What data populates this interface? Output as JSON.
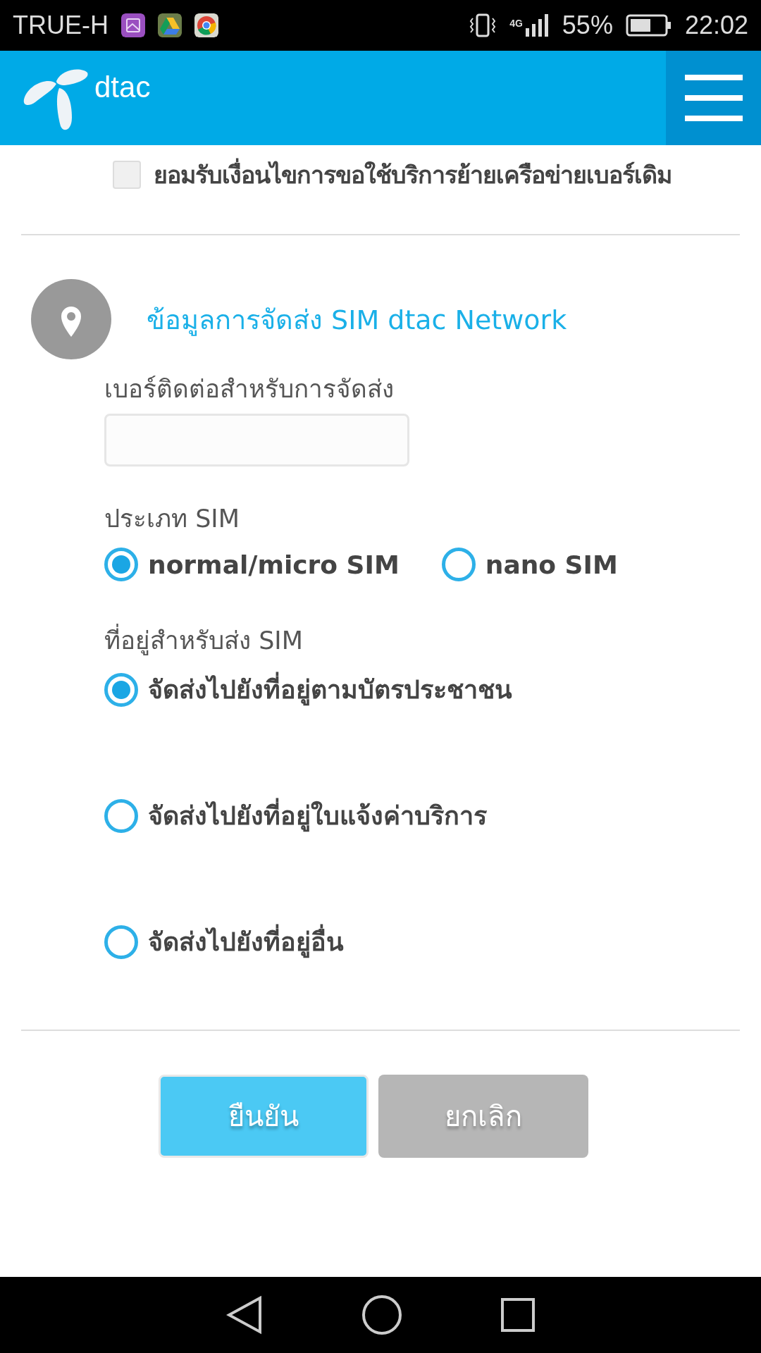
{
  "status_bar": {
    "carrier": "TRUE-H",
    "network": "4G",
    "battery": "55%",
    "time": "22:02"
  },
  "header": {
    "logo_text": "dtac"
  },
  "agreement": {
    "label": "ยอมรับเงื่อนไขการขอใช้บริการย้ายเครือข่ายเบอร์เดิม",
    "checked": false
  },
  "delivery": {
    "title": "ข้อมูลการจัดส่ง SIM dtac Network",
    "phone_field": {
      "label": "เบอร์ติดต่อสำหรับการจัดส่ง"
    },
    "sim_type": {
      "label": "ประเภท SIM",
      "options": [
        {
          "label": "normal/micro SIM",
          "selected": true
        },
        {
          "label": "nano SIM",
          "selected": false
        }
      ]
    },
    "address": {
      "label": "ที่อยู่สำหรับส่ง SIM",
      "options": [
        {
          "label": "จัดส่งไปยังที่อยู่ตามบัตรประชาชน",
          "selected": true
        },
        {
          "label": "จัดส่งไปยังที่อยู่ใบแจ้งค่าบริการ",
          "selected": false
        },
        {
          "label": "จัดส่งไปยังที่อยู่อื่น",
          "selected": false
        }
      ]
    }
  },
  "buttons": [
    {
      "label": "ยืนยัน",
      "kind": "primary"
    },
    {
      "label": "ยกเลิก",
      "kind": "secondary"
    }
  ]
}
